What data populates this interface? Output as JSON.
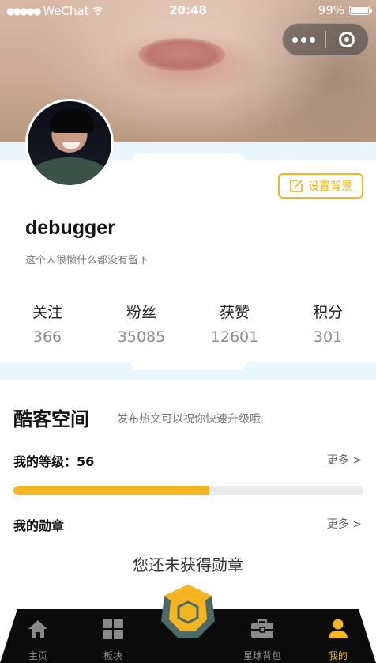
{
  "status_bar": {
    "carrier": "WeChat",
    "time": "20:48",
    "battery": "99%"
  },
  "profile": {
    "set_background_label": "设置背景",
    "username": "debugger",
    "bio": "这个人很懒什么都没有留下"
  },
  "stats": [
    {
      "label": "关注",
      "value": "366"
    },
    {
      "label": "粉丝",
      "value": "35085"
    },
    {
      "label": "获赞",
      "value": "12601"
    },
    {
      "label": "积分",
      "value": "301"
    }
  ],
  "geek_space": {
    "title": "酷客空间",
    "subtitle": "发布热文可以祝你快速升级哦",
    "level_label": "我的等级：56",
    "level_progress_fraction": 0.56,
    "more_label": "更多 >",
    "medals_label": "我的勋章",
    "medals_more_label": "更多 >",
    "no_medal_text": "您还未获得勋章"
  },
  "tabs": [
    {
      "label": "主页",
      "icon": "home-icon",
      "active": false
    },
    {
      "label": "板块",
      "icon": "grid-icon",
      "active": false
    },
    {
      "label": "星球背包",
      "icon": "briefcase-icon",
      "active": false
    },
    {
      "label": "我的",
      "icon": "user-icon",
      "active": true
    }
  ],
  "colors": {
    "accent": "#f5b51e",
    "tab_bar": "#0b0b0b",
    "band": "#e8f6fd",
    "center_button_outer": "#4a6b6a"
  }
}
